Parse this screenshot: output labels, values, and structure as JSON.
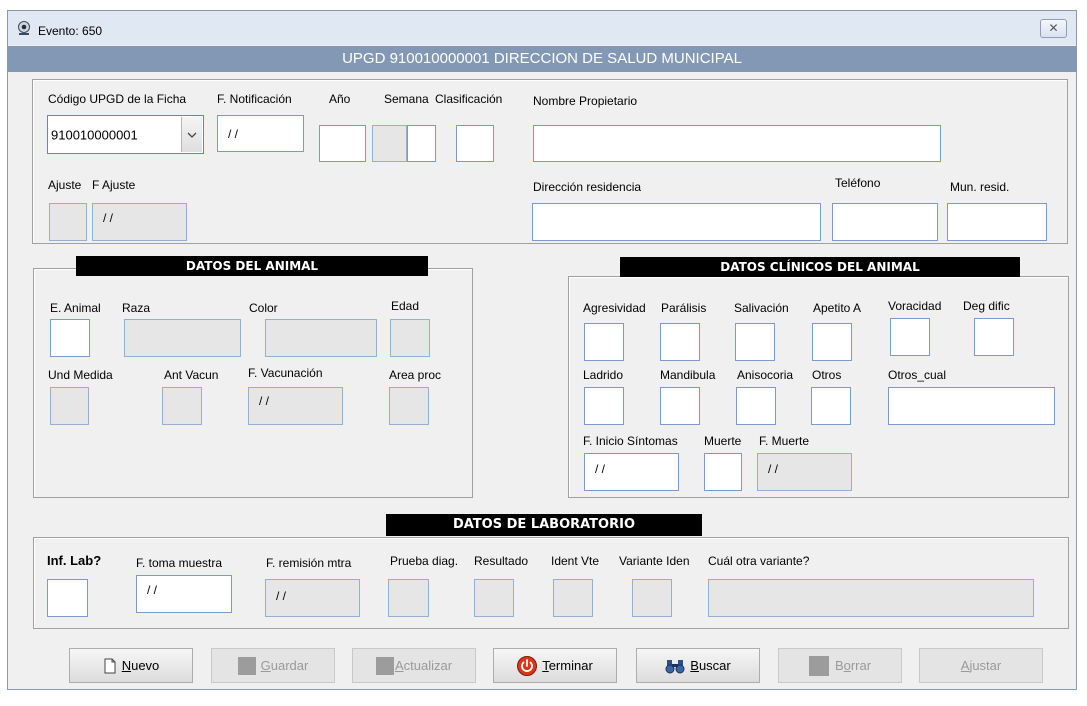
{
  "window": {
    "title": "Evento: 650",
    "close_glyph": "✕",
    "header": "UPGD 910010000001 DIRECCION DE SALUD MUNICIPAL"
  },
  "top": {
    "labels": {
      "codigo_upgd": "Código UPGD de la Ficha",
      "f_notificacion": "F. Notificación",
      "anio": "Año",
      "semana": "Semana",
      "clasificacion": "Clasificación",
      "nombre_propietario": "Nombre Propietario",
      "ajuste": "Ajuste",
      "f_ajuste": "F Ajuste",
      "direccion": "Dirección residencia",
      "telefono": "Teléfono",
      "mun_resid": "Mun. resid."
    },
    "codigo_upgd_value": "910010000001",
    "f_notificacion_value": "/ /",
    "f_ajuste_value": "/ /"
  },
  "animal": {
    "title": "DATOS DEL ANIMAL",
    "labels": {
      "e_animal": "E. Animal",
      "raza": "Raza",
      "color": "Color",
      "edad": "Edad",
      "und_medida": "Und Medida",
      "ant_vacun": "Ant Vacun",
      "f_vacunacion": "F. Vacunación",
      "area_proc": "Area proc"
    },
    "f_vacunacion_value": "/ /"
  },
  "clinicos": {
    "title": "DATOS CLÍNICOS DEL ANIMAL",
    "labels": {
      "agresividad": "Agresividad",
      "paralisis": "Parálisis",
      "salivacion": "Salivación",
      "apetito": "Apetito A",
      "voracidad": "Voracidad",
      "deg_dific": "Deg dific",
      "ladrido": "Ladrido",
      "mandibula": "Mandibula",
      "anisocoria": "Anisocoria",
      "otros": "Otros",
      "otros_cual": "Otros_cual",
      "f_inicio": "F. Inicio Síntomas",
      "muerte": "Muerte",
      "f_muerte": "F. Muerte"
    },
    "f_inicio_value": "/ /",
    "f_muerte_value": "/ /"
  },
  "lab": {
    "title": "DATOS DE LABORATORIO",
    "labels": {
      "inf_lab": "Inf. Lab?",
      "f_toma": "F. toma muestra",
      "f_remision": "F. remisión mtra",
      "prueba": "Prueba diag.",
      "resultado": "Resultado",
      "ident_vte": "Ident Vte",
      "variante": "Variante Iden",
      "cual_otra": "Cuál otra variante?"
    },
    "f_toma_value": "/ /",
    "f_remision_value": "/ /"
  },
  "buttons": {
    "nuevo": {
      "key": "N",
      "rest": "uevo"
    },
    "guardar": {
      "key": "G",
      "rest": "uardar"
    },
    "actualizar": {
      "key": "A",
      "rest": "ctualizar"
    },
    "terminar": {
      "key": "T",
      "rest": "erminar"
    },
    "buscar": {
      "key": "B",
      "rest": "uscar"
    },
    "borrar": {
      "pre": "B",
      "key": "o",
      "rest": "rrar"
    },
    "ajustar": {
      "key": "A",
      "rest": "justar"
    }
  },
  "colors": {
    "header_band": "#8398b4",
    "terminar_icon": "#d9361a",
    "field_border": "#7a9cc6"
  }
}
